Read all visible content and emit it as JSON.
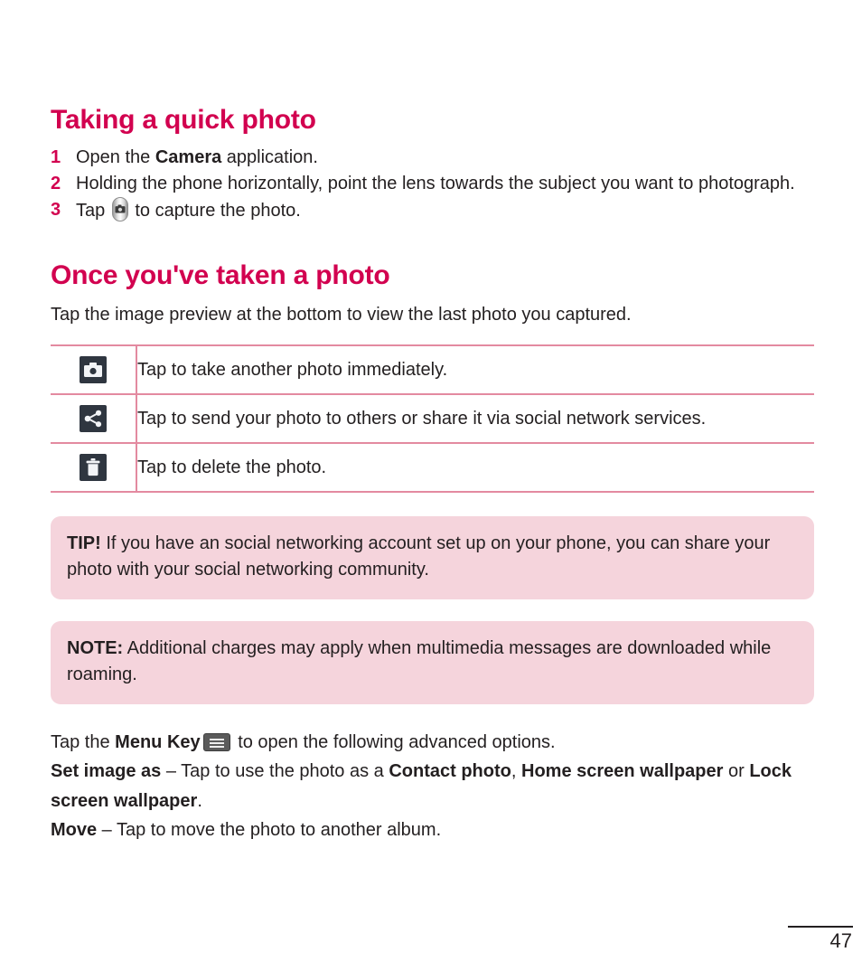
{
  "document": {
    "page_number": "47"
  },
  "section1": {
    "heading": "Taking a quick photo",
    "steps": [
      {
        "num": "1",
        "pre": "Open the ",
        "bold": "Camera",
        "post": " application.",
        "icon": ""
      },
      {
        "num": "2",
        "pre": "Holding the phone horizontally, point the lens towards the subject you want to photograph.",
        "bold": "",
        "post": "",
        "icon": ""
      },
      {
        "num": "3",
        "pre": "Tap ",
        "bold": "",
        "post": " to capture the photo.",
        "icon": "camera-shutter-icon"
      }
    ]
  },
  "section2": {
    "heading": "Once you've taken a photo",
    "intro": "Tap the image preview at the bottom to view the last photo you captured.",
    "table": {
      "rows": [
        {
          "icon": "camera-icon",
          "description": "Tap to take another photo immediately."
        },
        {
          "icon": "share-icon",
          "description": "Tap to send your photo to others or share it via social network services."
        },
        {
          "icon": "trash-icon",
          "description": "Tap to delete the photo."
        }
      ]
    }
  },
  "callouts": [
    {
      "lead": "TIP!",
      "text": " If you have an social networking account set up on your phone, you can share your photo with your social networking community."
    },
    {
      "lead": "NOTE:",
      "text": " Additional charges may apply when multimedia messages are downloaded while roaming."
    }
  ],
  "body": {
    "menu_line": {
      "pre": "Tap the ",
      "bold": "Menu Key",
      "icon": "menu-key-icon",
      "post": " to open the following advanced options."
    },
    "set_image_as": {
      "term": "Set image as",
      "dash": " – ",
      "text1": "Tap to use the photo as a ",
      "opt1": "Contact photo",
      "sep1": ", ",
      "opt2": "Home screen wallpaper",
      "sep2": " or ",
      "opt3": "Lock screen wallpaper",
      "end": "."
    },
    "move": {
      "term": "Move",
      "dash": " – ",
      "text": "Tap to move the photo to another album."
    }
  },
  "colors": {
    "heading": "#d2004f",
    "step_number": "#d2004f",
    "table_border": "#e38aa0",
    "callout_bg": "#f5d4dc",
    "body_text": "#231f20",
    "icon_tile": "#2f3640"
  }
}
